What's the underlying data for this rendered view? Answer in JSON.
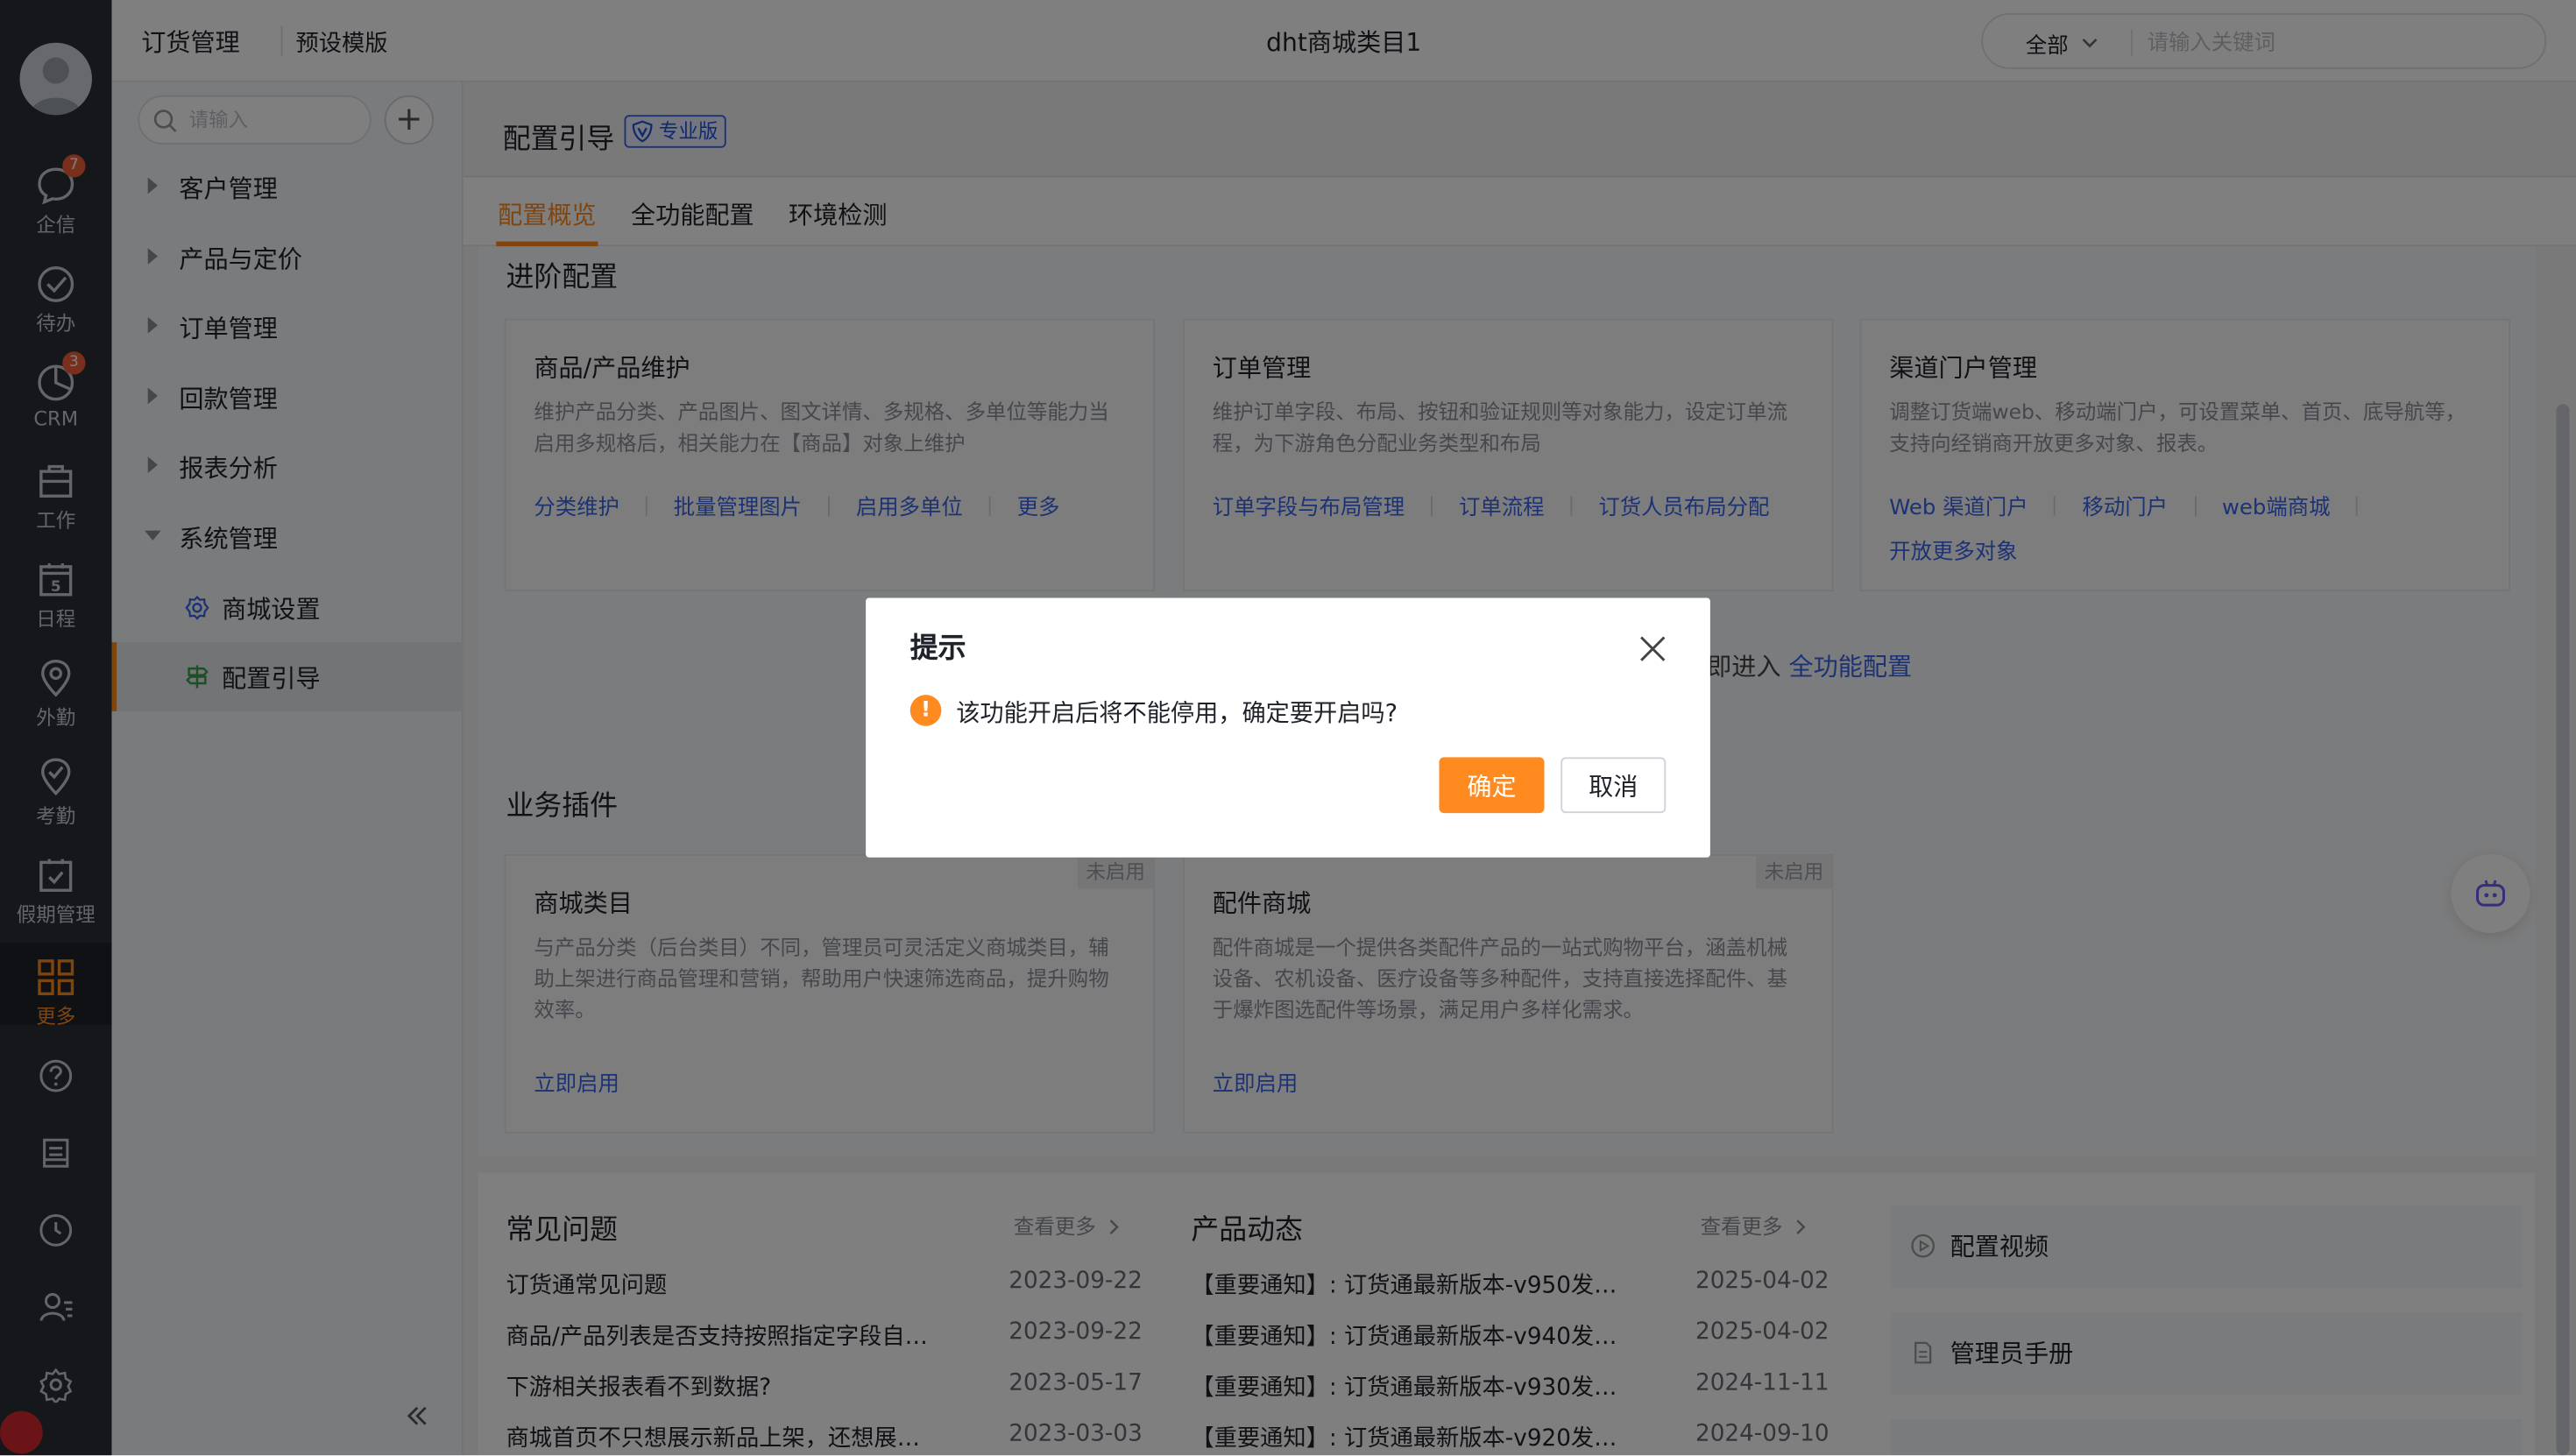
{
  "rail": {
    "items": [
      {
        "label": "企信",
        "badge": "7"
      },
      {
        "label": "待办"
      },
      {
        "label": "CRM",
        "badge": "3"
      },
      {
        "label": "工作"
      },
      {
        "label": "日程",
        "day": "5"
      },
      {
        "label": "外勤"
      },
      {
        "label": "考勤"
      },
      {
        "label": "假期管理"
      },
      {
        "label": "更多"
      }
    ]
  },
  "topbar": {
    "app_title": "订货管理",
    "sub_link": "预设模版",
    "page_title": "dht商城类目1",
    "search_scope": "全部",
    "search_placeholder": "请输入关键词"
  },
  "sidebar": {
    "search_placeholder": "请输入",
    "add_label": "+",
    "items": [
      "客户管理",
      "产品与定价",
      "订单管理",
      "回款管理",
      "报表分析",
      "系统管理"
    ],
    "children": [
      "商城设置",
      "配置引导"
    ]
  },
  "main": {
    "title": "配置引导",
    "edition_badge": "专业版",
    "tabs": [
      "配置概览",
      "全功能配置",
      "环境检测"
    ],
    "advanced": {
      "title": "进阶配置",
      "cards": [
        {
          "title": "商品/产品维护",
          "desc": "维护产品分类、产品图片、图文详情、多规格、多单位等能力当启用多规格后，相关能力在【商品】对象上维护",
          "links": [
            "分类维护",
            "批量管理图片",
            "启用多单位",
            "更多"
          ]
        },
        {
          "title": "订单管理",
          "desc": "维护订单字段、布局、按钮和验证规则等对象能力，设定订单流程，为下游角色分配业务类型和布局",
          "links": [
            "订单字段与布局管理",
            "订单流程",
            "订货人员布局分配"
          ]
        },
        {
          "title": "渠道门户管理",
          "desc": "调整订货端web、移动端门户，可设置菜单、首页、底导航等，支持向经销商开放更多对象、报表。",
          "links": [
            "Web 渠道门户",
            "移动门户",
            "web端商城"
          ],
          "links2": [
            "开放更多对象"
          ]
        }
      ],
      "enter_hint": "即进入",
      "enter_link": "全功能配置"
    },
    "plugins": {
      "title": "业务插件",
      "cards": [
        {
          "title": "商城类目",
          "tag": "未启用",
          "desc": "与产品分类（后台类目）不同，管理员可灵活定义商城类目，辅助上架进行商品管理和营销，帮助用户快速筛选商品，提升购物效率。",
          "action": "立即启用"
        },
        {
          "title": "配件商城",
          "tag": "未启用",
          "desc": "配件商城是一个提供各类配件产品的一站式购物平台，涵盖机械设备、农机设备、医疗设备等多种配件，支持直接选择配件、基于爆炸图选配件等场景，满足用户多样化需求。",
          "action": "立即启用"
        }
      ]
    },
    "faq": {
      "title": "常见问题",
      "more": "查看更多",
      "rows": [
        {
          "text": "订货通常见问题",
          "date": "2023-09-22"
        },
        {
          "text": "商品/产品列表是否支持按照指定字段自…",
          "date": "2023-09-22"
        },
        {
          "text": "下游相关报表看不到数据?",
          "date": "2023-05-17"
        },
        {
          "text": "商城首页不只想展示新品上架，还想展…",
          "date": "2023-03-03"
        }
      ]
    },
    "news": {
      "title": "产品动态",
      "more": "查看更多",
      "rows": [
        {
          "text": "【重要通知】: 订货通最新版本-v950发…",
          "date": "2025-04-02"
        },
        {
          "text": "【重要通知】: 订货通最新版本-v940发…",
          "date": "2025-04-02"
        },
        {
          "text": "【重要通知】: 订货通最新版本-v930发…",
          "date": "2024-11-11"
        },
        {
          "text": "【重要通知】: 订货通最新版本-v920发…",
          "date": "2024-09-10"
        }
      ]
    },
    "resources": [
      "配置视频",
      "管理员手册"
    ]
  },
  "dialog": {
    "title": "提示",
    "message": "该功能开启后将不能停用，确定要开启吗?",
    "confirm": "确定",
    "cancel": "取消"
  },
  "colors": {
    "accent": "#ff8a1f",
    "link": "#3a64e6",
    "rail_bg": "#2a2e37",
    "badge": "#f0603b"
  }
}
